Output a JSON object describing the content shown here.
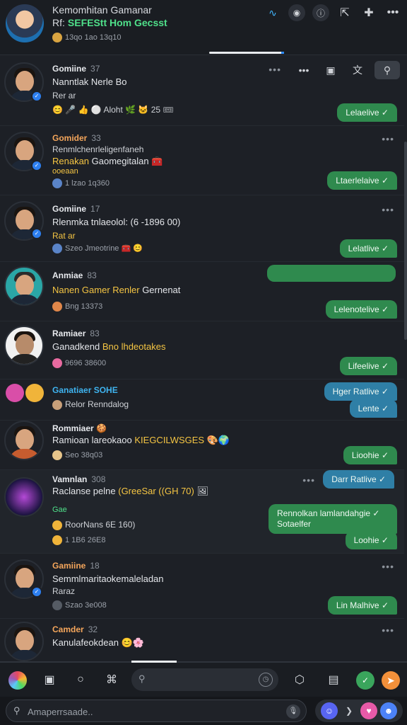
{
  "header": {
    "title": "Kemomhitan Gamanar",
    "subtitle_prefix": "Rf:",
    "subtitle": "SEFEStt Hom Gecsst",
    "meta": "13qo 1ao 13q10",
    "icons": [
      "wave-icon",
      "person-icon",
      "info-icon",
      "share-icon",
      "puzzle-icon",
      "more-icon"
    ]
  },
  "row_toolbar": {
    "icons": [
      "more-icon",
      "square-icon",
      "translate-icon",
      "filter-icon"
    ]
  },
  "rows": [
    {
      "name": "Gomiine",
      "num": "37",
      "line2": "Nanntlak Nerle Bo",
      "line3": "Rer ar",
      "line4": "Aloht",
      "emojis": "😊 🎤 👍 ⚪ 🌿 🐱 👑 25 🎟",
      "bubble": "Lelaelive ✓"
    },
    {
      "name": "Gomider",
      "num": "33",
      "line2": "Renmlchenrleligenfaneh",
      "line3a": "Renakan ",
      "line3b": "Gaomegitalan",
      "line3c": "ooeaan",
      "line4": "1 lzao 1q360",
      "bubble": "Ltaerlelaive ✓"
    },
    {
      "name": "Gomiine",
      "num": "17",
      "line2": "Rlenmka tnlaeolol: (6 -1896 00)",
      "line3": "Rat ar",
      "line4": "Szeo Jmeotrine",
      "bubble": "Lelatlive ✓"
    },
    {
      "name": "Anmiae",
      "num": "83",
      "line2": "Nanen Gamer Renler",
      "line2b": "Gernenat",
      "line4": "Bng 13373",
      "bubble": "Lelenotelive ✓"
    },
    {
      "name": "Ramiaer",
      "num": "83",
      "line2": "Ganadkend ",
      "line2b": "Bno lhdeotakes",
      "line4": "9696 38600",
      "bubble": "Lifeelive ✓"
    },
    {
      "name": "Ganatiaer SOHE",
      "line4": "Relor Renndalog",
      "bubble": "Hger Ratlive ✓",
      "bubble2": "Lente ✓"
    },
    {
      "name": "Rommiaer",
      "line2": "Ramioan lareokaoo ",
      "line2b": "KIEGCILWSGES",
      "line4": "Seo 38q03",
      "bubble": "Lioohie ✓"
    },
    {
      "name": "Vamnlan",
      "num": "308",
      "line2": "Raclanse pelne ",
      "line2b": "(GreeSar ((GH 70)",
      "line3": "Gae",
      "line4a": "RoorNans 6E 160)",
      "line4b": "1 1B6 26E8",
      "bubble": "Darr Ratlive ✓",
      "bubble_multi": "Rennolkan lamlandahgie ✓ Sotaelfer",
      "bubble2": "Loohie ✓"
    },
    {
      "name": "Gamiine",
      "num": "18",
      "line2": "Semmlmaritaokemaleladan",
      "line3": "Raraz",
      "line4": "Szao 3e008",
      "bubble": "Lin Malhive ✓"
    },
    {
      "name": "Camder",
      "num": "32",
      "line2": "Kanulafeokdean"
    }
  ],
  "toolbar": {
    "search_icon": "🔍"
  },
  "compose": {
    "placeholder": "Amaperrsaade..",
    "icons": [
      "search-icon",
      "mic-icon",
      "emoji-icon",
      "heart-icon",
      "react-icon"
    ]
  },
  "colors": {
    "background": "#1d2026",
    "accent_green": "#2f8a4e",
    "accent_blue": "#2f7fa6",
    "highlight_yellow": "#f5c543",
    "subtitle_green": "#4fe08a"
  }
}
